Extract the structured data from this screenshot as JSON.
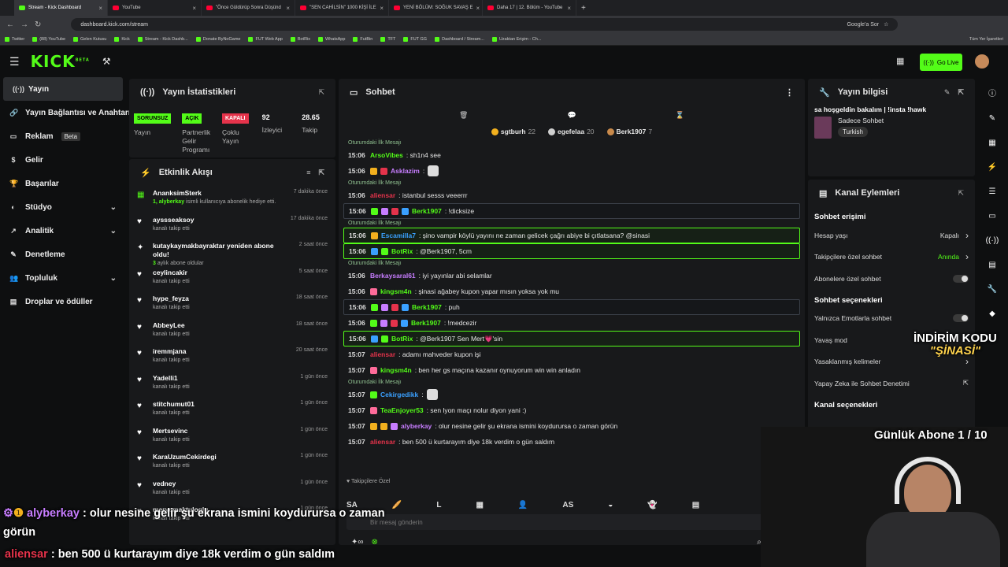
{
  "browser": {
    "tabs": [
      {
        "label": "Stream - Kick Dashboard",
        "active": true,
        "kind": "kick"
      },
      {
        "label": "YouTube",
        "active": false,
        "kind": "yt"
      },
      {
        "label": "\"Önce Güldürüp Sonra Düşünd",
        "active": false,
        "kind": "yt"
      },
      {
        "label": "\"SEN CAHİLSİN\" 1000 KİŞİ İLE",
        "active": false,
        "kind": "yt"
      },
      {
        "label": "YENİ BÖLÜM: SOĞUK SAVAŞ E",
        "active": false,
        "kind": "yt"
      },
      {
        "label": "Daha 17 | 12. Bölüm - YouTube",
        "active": false,
        "kind": "yt"
      }
    ],
    "url": "dashboard.kick.com/stream",
    "google_btn": "Google'a Sor",
    "bookmarks": [
      "Twitter",
      "(88) YouTube",
      "Gelen Kutusu",
      "Kick",
      "Stream - Kick Dashb...",
      "Donate ByNoGame",
      "FUT Web App",
      "BotRix",
      "WhatsApp",
      "FutBin",
      "TFT",
      "FUT GG",
      "Dashboard / Stream...",
      "Uzaktan Erişim - Ch..."
    ],
    "all_bookmarks": "Tüm Yer İşaretleri"
  },
  "header": {
    "logo": "KICK",
    "logo_beta": "BETA",
    "go_live": "Go Live"
  },
  "sidebar": {
    "items": [
      {
        "label": "Yayın",
        "icon": "broadcast-icon",
        "glyph": "((·))",
        "active": true
      },
      {
        "label": "Yayın Bağlantısı ve Anahtarı",
        "icon": "link-icon",
        "glyph": "🔗"
      },
      {
        "label": "Reklam",
        "icon": "tv-icon",
        "glyph": "▭",
        "badge": "Beta"
      },
      {
        "label": "Gelir",
        "icon": "money-icon",
        "glyph": "$"
      },
      {
        "label": "Başarılar",
        "icon": "trophy-icon",
        "glyph": "🏆"
      },
      {
        "label": "Stüdyo",
        "icon": "palette-icon",
        "glyph": "◐",
        "chevron": true
      },
      {
        "label": "Analitik",
        "icon": "chart-icon",
        "glyph": "↗",
        "chevron": true
      },
      {
        "label": "Denetleme",
        "icon": "hammer-icon",
        "glyph": "✎"
      },
      {
        "label": "Topluluk",
        "icon": "people-icon",
        "glyph": "👥",
        "chevron": true
      },
      {
        "label": "Droplar ve ödüller",
        "icon": "gift-icon",
        "glyph": "▤"
      }
    ]
  },
  "stats": {
    "title": "Yayın İstatistikleri",
    "items": [
      {
        "badge": "SORUNSUZ",
        "badge_color": "#53fc18",
        "label": "Yayın"
      },
      {
        "badge": "AÇIK",
        "badge_color": "#53fc18",
        "label": "Partnerlik Gelir Programı"
      },
      {
        "badge": "KAPALI",
        "badge_color": "#e5334b",
        "label": "Çoklu Yayın"
      },
      {
        "num": "92",
        "label": "İzleyici"
      },
      {
        "num": "28.65",
        "label": "Takip"
      }
    ]
  },
  "activity": {
    "title": "Etkinlik Akışı",
    "events": [
      {
        "name": "AnanksimSterk",
        "sub_pre": "1, alyberkay",
        "sub": " isimli kullanıcıya abonelik hediye etti.",
        "time": "7 dakika önce",
        "icon": "gift-icon",
        "glyph": "▦"
      },
      {
        "name": "ayssseaksoy",
        "sub": "kanalı takip etti",
        "time": "17 dakika önce",
        "icon": "heart-icon",
        "glyph": "♥"
      },
      {
        "name": "kutaykaymakbayraktar yeniden abone oldu!",
        "sub_pre": "3",
        "sub": " aylık abone oldular",
        "time": "2 saat önce",
        "icon": "star-icon",
        "glyph": "✦"
      },
      {
        "name": "ceylincakir",
        "sub": "kanalı takip etti",
        "time": "5 saat önce",
        "icon": "heart-icon",
        "glyph": "♥"
      },
      {
        "name": "hype_feyza",
        "sub": "kanalı takip etti",
        "time": "18 saat önce",
        "icon": "heart-icon",
        "glyph": "♥"
      },
      {
        "name": "AbbeyLee",
        "sub": "kanalı takip etti",
        "time": "18 saat önce",
        "icon": "heart-icon",
        "glyph": "♥"
      },
      {
        "name": "iremmjana",
        "sub": "kanalı takip etti",
        "time": "20 saat önce",
        "icon": "heart-icon",
        "glyph": "♥"
      },
      {
        "name": "Yadelli1",
        "sub": "kanalı takip etti",
        "time": "1 gün önce",
        "icon": "heart-icon",
        "glyph": "♥"
      },
      {
        "name": "stitchumut01",
        "sub": "kanalı takip etti",
        "time": "1 gün önce",
        "icon": "heart-icon",
        "glyph": "♥"
      },
      {
        "name": "Mertsevinc",
        "sub": "kanalı takip etti",
        "time": "1 gün önce",
        "icon": "heart-icon",
        "glyph": "♥"
      },
      {
        "name": "KaraUzumCekirdegi",
        "sub": "kanalı takip etti",
        "time": "1 gün önce",
        "icon": "heart-icon",
        "glyph": "♥"
      },
      {
        "name": "vedney",
        "sub": "kanalı takip etti",
        "time": "1 gün önce",
        "icon": "heart-icon",
        "glyph": "♥"
      },
      {
        "name": "meryemaktuloglu",
        "sub": "kanalı takip etti",
        "time": "1 gün önce",
        "icon": "heart-icon",
        "glyph": "♥"
      }
    ]
  },
  "chat": {
    "title": "Sohbet",
    "pinned": [
      {
        "name": "sgtburh",
        "count": "22",
        "color": "#f2b01e"
      },
      {
        "name": "egefelaa",
        "count": "20",
        "color": "#cfcfcf"
      },
      {
        "name": "Berk1907",
        "count": "7",
        "color": "#c98a4b"
      }
    ],
    "first_label": "Oturumdaki İlk Mesajı",
    "messages": [
      {
        "time": "15:06",
        "user": "ArsoVibes",
        "color": "#53fc18",
        "text": ": sh1n4 see",
        "first": true
      },
      {
        "time": "15:06",
        "user": "Asklazim",
        "color": "#c77dff",
        "text": ":",
        "emote": true,
        "badges": [
          "#f2b01e",
          "#e5334b"
        ]
      },
      {
        "time": "15:06",
        "user": "aliensar",
        "color": "#e5334b",
        "text": ": istanbul sesss veeerrr",
        "first": true
      },
      {
        "time": "15:06",
        "user": "Berk1907",
        "color": "#53fc18",
        "text": ": !dicksize",
        "hl": true,
        "badges": [
          "#53fc18",
          "#c77dff",
          "#e5334b",
          "#3aa0ff"
        ]
      },
      {
        "time": "15:06",
        "user": "Escamilla7",
        "color": "#3aa0ff",
        "text": ": şino vampir köylü yayını ne zaman gelicek çağrı abiye bi çıtlatsana? @sinasi",
        "first": true,
        "hl2": true,
        "badges": [
          "#f2b01e"
        ]
      },
      {
        "time": "15:06",
        "user": "BotRix",
        "color": "#53fc18",
        "text": ": @Berk1907, 5cm",
        "hl2": true,
        "badges": [
          "#3aa0ff",
          "#53fc18"
        ]
      },
      {
        "time": "15:06",
        "user": "Berkaysaral61",
        "color": "#c77dff",
        "text": ": iyi yayınlar abi selamlar",
        "first": true
      },
      {
        "time": "15:06",
        "user": "kingsm4n",
        "color": "#53fc18",
        "text": ": şinasi ağabey kupon yapar mısın yoksa yok mu",
        "badges": [
          "#ff6b9a"
        ]
      },
      {
        "time": "15:06",
        "user": "Berk1907",
        "color": "#53fc18",
        "text": ": puh",
        "hl": true,
        "badges": [
          "#53fc18",
          "#c77dff",
          "#e5334b",
          "#3aa0ff"
        ]
      },
      {
        "time": "15:06",
        "user": "Berk1907",
        "color": "#53fc18",
        "text": ": !medcezir",
        "badges": [
          "#53fc18",
          "#c77dff",
          "#e5334b",
          "#3aa0ff"
        ]
      },
      {
        "time": "15:06",
        "user": "BotRix",
        "color": "#53fc18",
        "text": ": @Berk1907 Sen Mert💗'sin",
        "hl2": true,
        "badges": [
          "#3aa0ff",
          "#53fc18"
        ]
      },
      {
        "time": "15:07",
        "user": "aliensar",
        "color": "#e5334b",
        "text": ": adamı mahveder kupon işi"
      },
      {
        "time": "15:07",
        "user": "kingsm4n",
        "color": "#53fc18",
        "text": ": ben her gs maçına kazanır oynuyorum win win anladın",
        "badges": [
          "#ff6b9a"
        ]
      },
      {
        "time": "15:07",
        "user": "Cekirgedikk",
        "color": "#3aa0ff",
        "text": ":",
        "first": true,
        "emote": true,
        "badges": [
          "#53fc18"
        ]
      },
      {
        "time": "15:07",
        "user": "TeaEnjoyer53",
        "color": "#53fc18",
        "text": ": sen lyon maçı nolur diyon yani :)",
        "badges": [
          "#ff6b9a"
        ]
      },
      {
        "time": "15:07",
        "user": "alyberkay",
        "color": "#c77dff",
        "text": ": olur nesine gelir şu ekrana ismini koydurursa o zaman görün",
        "badges": [
          "#f2b01e",
          "#f2b01e",
          "#c77dff"
        ]
      },
      {
        "time": "15:07",
        "user": "aliensar",
        "color": "#e5334b",
        "text": ": ben 500 ü kurtarayım diye 18k verdim o gün saldım"
      }
    ],
    "subscribers_label": "♥ Takipçilere Özel",
    "emotes": [
      "SA",
      "🥖",
      "L",
      "▦",
      "👤",
      "AS",
      "◒",
      "👻",
      "▤"
    ],
    "input_placeholder": "Bir mesaj gönderin"
  },
  "info": {
    "title": "Yayın bilgisi",
    "stream_title": "sa hoşgeldin bakalım | !insta !hawk",
    "category": "Sadece Sohbet",
    "language": "Turkish"
  },
  "channel_actions": {
    "title": "Kanal Eylemleri",
    "chat_access": "Sohbet erişimi",
    "chat_options": "Sohbet seçenekleri",
    "channel_options": "Kanal seçenekleri",
    "access_rows": [
      {
        "label": "Hesap yaşı",
        "value": "Kapalı",
        "chev": true
      },
      {
        "label": "Takipçilere özel sohbet",
        "value": "Anında",
        "value_color": "#53fc18",
        "chev": true
      },
      {
        "label": "Abonelere özel sohbet",
        "toggle": true
      }
    ],
    "option_rows": [
      {
        "label": "Yalnızca Emotlarla sohbet",
        "toggle": true
      },
      {
        "label": "Yavaş mod",
        "value": ""
      },
      {
        "label": "Yasaklanmış kelimeler",
        "chev": true
      },
      {
        "label": "Yapay Zeka ile Sohbet Denetimi",
        "ext": true
      }
    ]
  },
  "overlays": {
    "promo_line1": "İNDİRİM KODU",
    "promo_line2": "\"ŞİNASİ\"",
    "daily_sub": "Günlük Abone 1 / 10",
    "ov_user1": "alyberkay",
    "ov_msg1": " : olur nesine gelir şu ekrana ismini koydurursa o zaman",
    "ov_msg1b": "görün",
    "ov_user2": "aliensar",
    "ov_msg2": " : ben 500 ü kurtarayım diye 18k verdim o gün saldım"
  },
  "colors": {
    "accent": "#53fc18",
    "panel": "#18191b",
    "background": "#0e0f10"
  }
}
